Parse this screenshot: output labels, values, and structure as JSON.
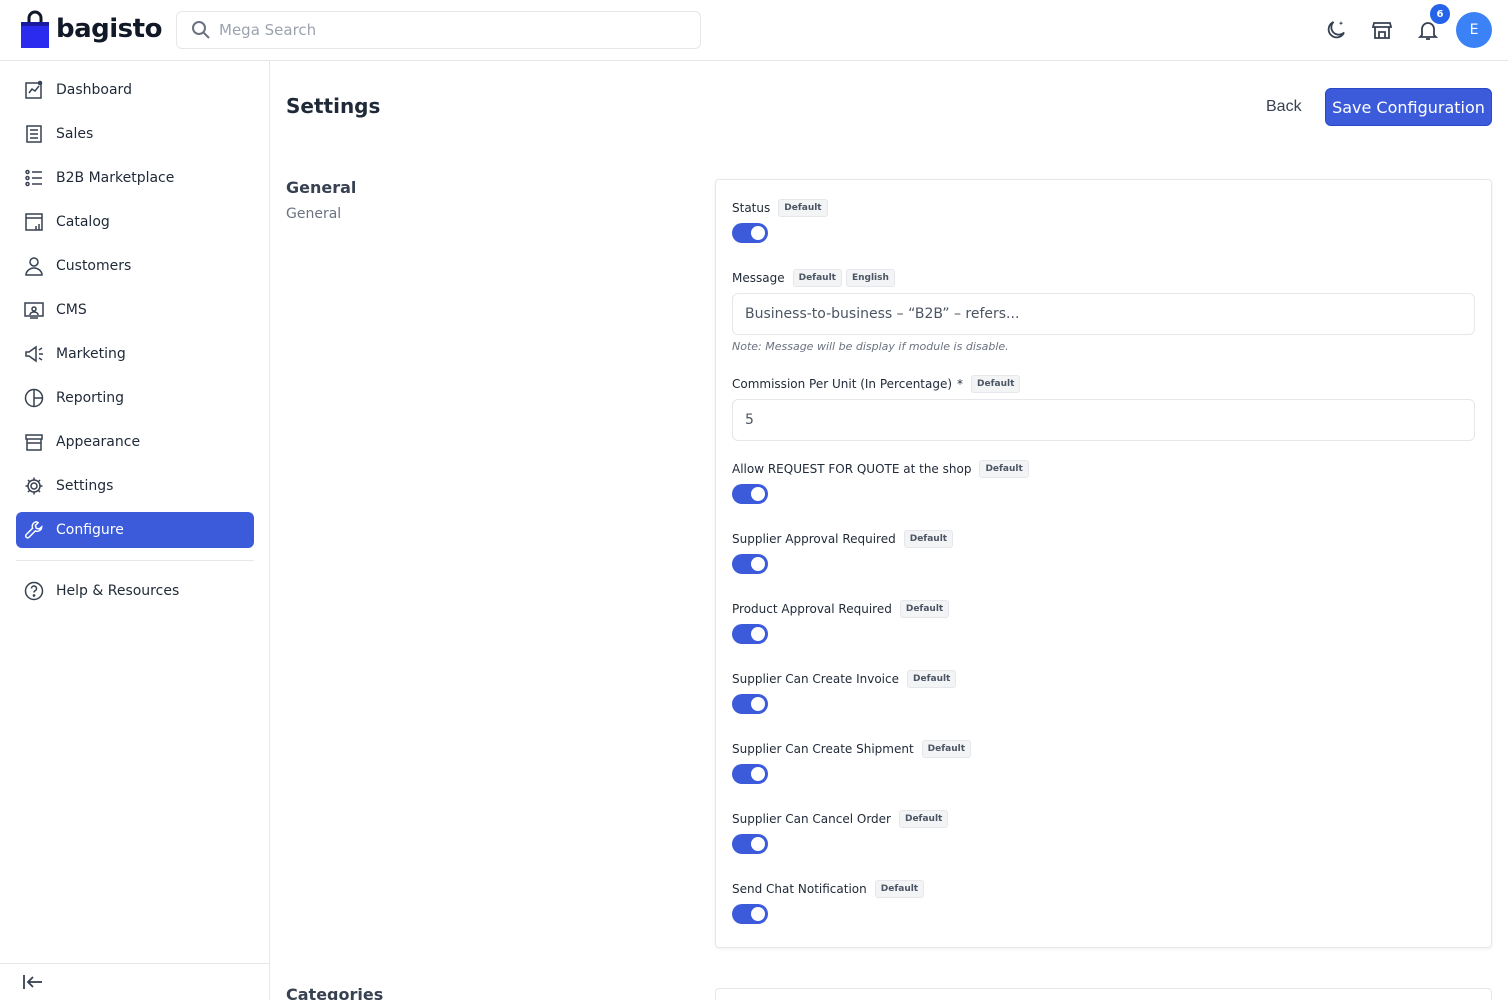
{
  "header": {
    "logo_text": "bagisto",
    "search_placeholder": "Mega Search",
    "notification_count": "6",
    "avatar_initial": "E"
  },
  "sidebar": {
    "items": [
      {
        "label": "Dashboard",
        "icon": "dashboard-icon"
      },
      {
        "label": "Sales",
        "icon": "sales-icon"
      },
      {
        "label": "B2B Marketplace",
        "icon": "list-icon"
      },
      {
        "label": "Catalog",
        "icon": "catalog-icon"
      },
      {
        "label": "Customers",
        "icon": "customer-icon"
      },
      {
        "label": "CMS",
        "icon": "cms-icon"
      },
      {
        "label": "Marketing",
        "icon": "megaphone-icon"
      },
      {
        "label": "Reporting",
        "icon": "pie-chart-icon"
      },
      {
        "label": "Appearance",
        "icon": "store-icon"
      },
      {
        "label": "Settings",
        "icon": "gear-icon"
      },
      {
        "label": "Configure",
        "icon": "wrench-icon"
      }
    ],
    "active": "Configure",
    "help_label": "Help & Resources"
  },
  "page": {
    "title": "Settings",
    "back_label": "Back",
    "save_label": "Save Configuration"
  },
  "section": {
    "title": "General",
    "subtitle": "General",
    "next_title": "Categories"
  },
  "badges": {
    "default": "Default",
    "english": "English"
  },
  "fields": {
    "status": {
      "label": "Status",
      "enabled": true
    },
    "message": {
      "label": "Message",
      "value": "Business-to-business – “B2B” – refers...",
      "note": "Note: Message will be display if module is disable."
    },
    "commission": {
      "label": "Commission Per Unit (In Percentage)",
      "required_mark": "*",
      "value": "5"
    },
    "allow_rfq": {
      "label": "Allow REQUEST FOR QUOTE at the shop",
      "enabled": true
    },
    "supplier_approval": {
      "label": "Supplier Approval Required",
      "enabled": true
    },
    "product_approval": {
      "label": "Product Approval Required",
      "enabled": true
    },
    "create_invoice": {
      "label": "Supplier Can Create Invoice",
      "enabled": true
    },
    "create_shipment": {
      "label": "Supplier Can Create Shipment",
      "enabled": true
    },
    "cancel_order": {
      "label": "Supplier Can Cancel Order",
      "enabled": true
    },
    "chat_notification": {
      "label": "Send Chat Notification",
      "enabled": true
    }
  },
  "colors": {
    "primary": "#3b5bdb",
    "avatar": "#3b82f6"
  }
}
